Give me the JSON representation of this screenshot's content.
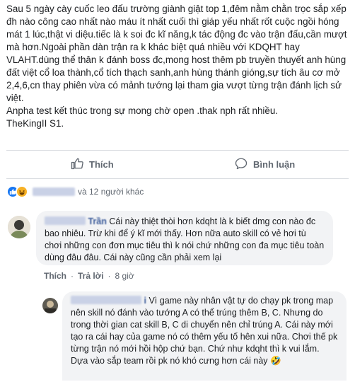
{
  "post": {
    "text": "Sau 5 ngày cày cuốc leo đấu trường giành giật top 1,đêm nằm chằn trọc sắp xếp đh nào công cao nhất nào máu ít nhất cuối thì giáp yếu nhất rốt cuộc ngồi hóng mát 1 lúc,thật vi diệu.tiếc là k soi đc kĩ năng,k tác động đc vào trận đấu,cần mượt mà hơn.Ngoài phần dàn trận ra k khác biệt quá nhiều với KDQHT hay VLAHT.dùng thể thân k đánh boss đc,mong host thêm pb truyền thuyết anh hùng đất việt cổ loa thành,cổ tích thạch sanh,anh hùng thánh gióng,sự tích âu cơ mở 2,4,6,cn thay phiên vừa có mảnh tướng lại tham gia vượt từng trận đánh lịch sử việt.\nAnpha test kết thúc trong sự mong chờ open .thak nph rất nhiều.\nTheKingII S1."
  },
  "actions": {
    "like_label": "Thích",
    "comment_label": "Bình luận"
  },
  "reactions": {
    "others_text": "và 12 người khác"
  },
  "comments": [
    {
      "author_visible": "Trần",
      "text": "Cái này thiệt thòi hơn kdqht là k biết dmg con nào đc bao nhiêu. Trừ khi để ý kĩ mới thấy. Hơn nữa auto skill có vẻ hơi tù chơi những con đơn mục tiêu thì k nói chứ những con đa mục tiêu toàn dùng đâu đâu. Cái này cũng cần phải xem lại",
      "like_label": "Thích",
      "reply_label": "Trả lời",
      "time": "8 giờ"
    },
    {
      "author_visible": "i",
      "text": "Vì game này nhân vật tự do chạy pk trong map nên skill nó đánh vào tướng A có thể trúng thêm B, C. Nhưng do trong thời gian cat skill B, C di chuyển nên chỉ trúng A. Cái này mới tạo ra cái hay của game nó có thêm yếu tố hên xui nữa. Chơi thế pk từng trận nó mới hồi hộp chứ bạn. Chứ như kdqht thì k vui lắm. Dựa vào sắp team rồi pk nó khó cưng hơn cái này 🤣"
    }
  ],
  "colors": {
    "link": "#385898",
    "meta": "#606770",
    "bubble": "#f2f3f5"
  }
}
